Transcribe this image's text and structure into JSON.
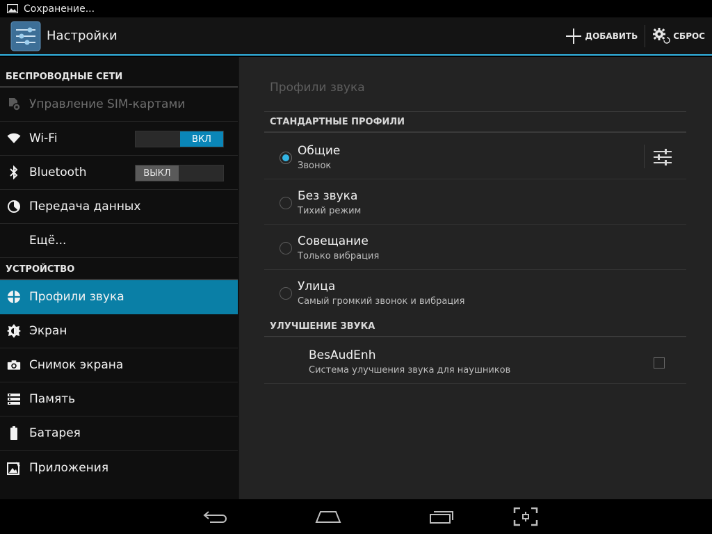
{
  "status_bar": {
    "notification_text": "Сохранение..."
  },
  "action_bar": {
    "title": "Настройки",
    "add_label": "ДОБАВИТЬ",
    "reset_label": "СБРОС"
  },
  "sidebar": {
    "section_wireless": "БЕСПРОВОДНЫЕ СЕТИ",
    "section_device": "УСТРОЙСТВО",
    "items": [
      {
        "label": "Управление SIM-картами",
        "icon": "sim-settings-icon"
      },
      {
        "label": "Wi-Fi",
        "icon": "wifi-icon",
        "toggle": "ВКЛ"
      },
      {
        "label": "Bluetooth",
        "icon": "bluetooth-icon",
        "toggle": "ВЫКЛ"
      },
      {
        "label": "Передача данных",
        "icon": "data-usage-icon"
      },
      {
        "label": "Ещё...",
        "icon": ""
      },
      {
        "label": "Профили звука",
        "icon": "audio-profiles-icon",
        "selected": true
      },
      {
        "label": "Экран",
        "icon": "display-brightness-icon"
      },
      {
        "label": "Снимок экрана",
        "icon": "camera-icon"
      },
      {
        "label": "Память",
        "icon": "storage-icon"
      },
      {
        "label": "Батарея",
        "icon": "battery-icon"
      },
      {
        "label": "Приложения",
        "icon": "apps-icon"
      }
    ]
  },
  "main": {
    "title": "Профили звука",
    "section_standard": "СТАНДАРТНЫЕ ПРОФИЛИ",
    "section_enhance": "УЛУЧШЕНИЕ ЗВУКА",
    "profiles": [
      {
        "title": "Общие",
        "subtitle": "Звонок",
        "checked": true
      },
      {
        "title": "Без звука",
        "subtitle": "Тихий режим",
        "checked": false
      },
      {
        "title": "Совещание",
        "subtitle": "Только вибрация",
        "checked": false
      },
      {
        "title": "Улица",
        "subtitle": "Самый громкий звонок и вибрация",
        "checked": false
      }
    ],
    "enhancement": {
      "title": "BesAudEnh",
      "subtitle": "Система улучшения звука для наушников",
      "checked": false
    }
  },
  "colors": {
    "accent": "#33b5e5",
    "selected_bg": "#0a7fa6",
    "toggle_on": "#0a86b8"
  }
}
